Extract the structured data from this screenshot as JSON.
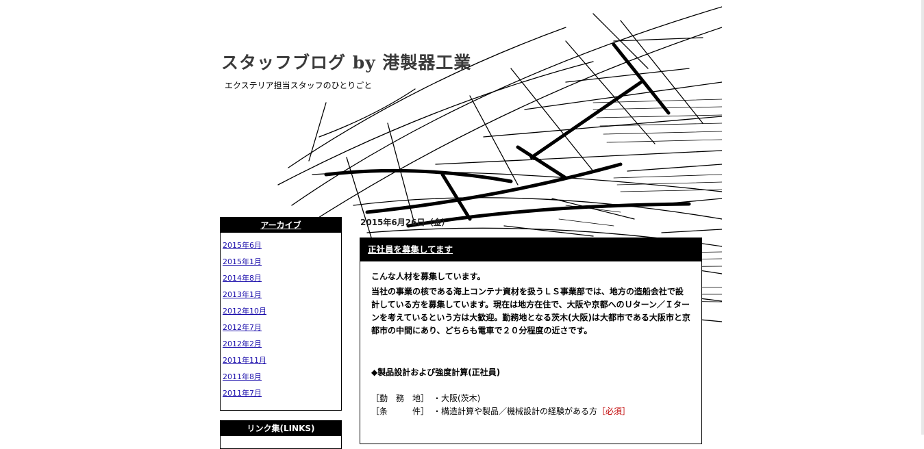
{
  "site": {
    "title": "スタッフブログ by 港製器工業",
    "description": "エクステリア担当スタッフのひとりごと"
  },
  "sidebar": {
    "archive": {
      "title": "アーカイブ",
      "items": [
        {
          "label": "2015年6月"
        },
        {
          "label": "2015年1月"
        },
        {
          "label": "2014年8月"
        },
        {
          "label": "2013年1月"
        },
        {
          "label": "2012年10月"
        },
        {
          "label": "2012年7月"
        },
        {
          "label": "2012年2月"
        },
        {
          "label": "2011年11月"
        },
        {
          "label": "2011年8月"
        },
        {
          "label": "2011年7月"
        }
      ]
    },
    "links": {
      "title": "リンク集(LINKS)"
    }
  },
  "post": {
    "date": "2015年6月26日（金）",
    "title": "正社員を募集してます",
    "intro": "こんな人材を募集しています。",
    "description": "当社の事業の核である海上コンテナ資材を扱うＬＳ事業部では、地方の造船会社で設計している方を募集しています。現在は地方在住で、大阪や京都へのＵターン／Ｉターンを考えているという方は大歓迎。勤務地となる茨木(大阪)は大都市である大阪市と京都市の中間にあり、どちらも電車で２０分程度の近さです。",
    "section_heading": "◆製品設計および強度計算(正社員)",
    "details": [
      {
        "label": "［勤　務　地］",
        "value": "・大阪(茨木)",
        "note": ""
      },
      {
        "label": "［条　　　件］",
        "value": "・構造計算や製品／機械設計の経験がある方",
        "note": "［必須］"
      }
    ]
  },
  "colors": {
    "accent": "#000000",
    "link": "#1a0dab",
    "required": "#c00000"
  }
}
